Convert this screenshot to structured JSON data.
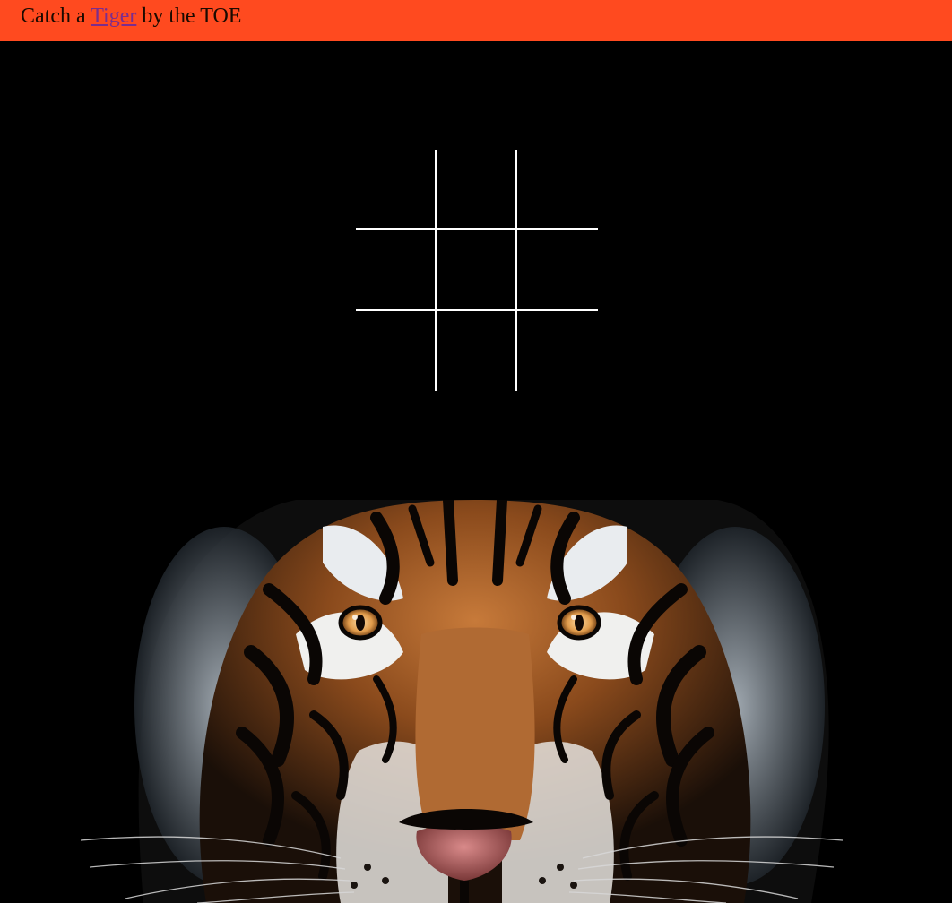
{
  "header": {
    "title_prefix": "Catch a ",
    "title_link": "Tiger",
    "title_suffix": " by the TOE",
    "background_color": "#ff4a1f",
    "link_color": "#7b2d8e"
  },
  "board": {
    "cells": [
      "",
      "",
      "",
      "",
      "",
      "",
      "",
      "",
      ""
    ],
    "line_color": "#ffffff"
  },
  "tiger_image": {
    "icon": "tiger-face-photo"
  }
}
